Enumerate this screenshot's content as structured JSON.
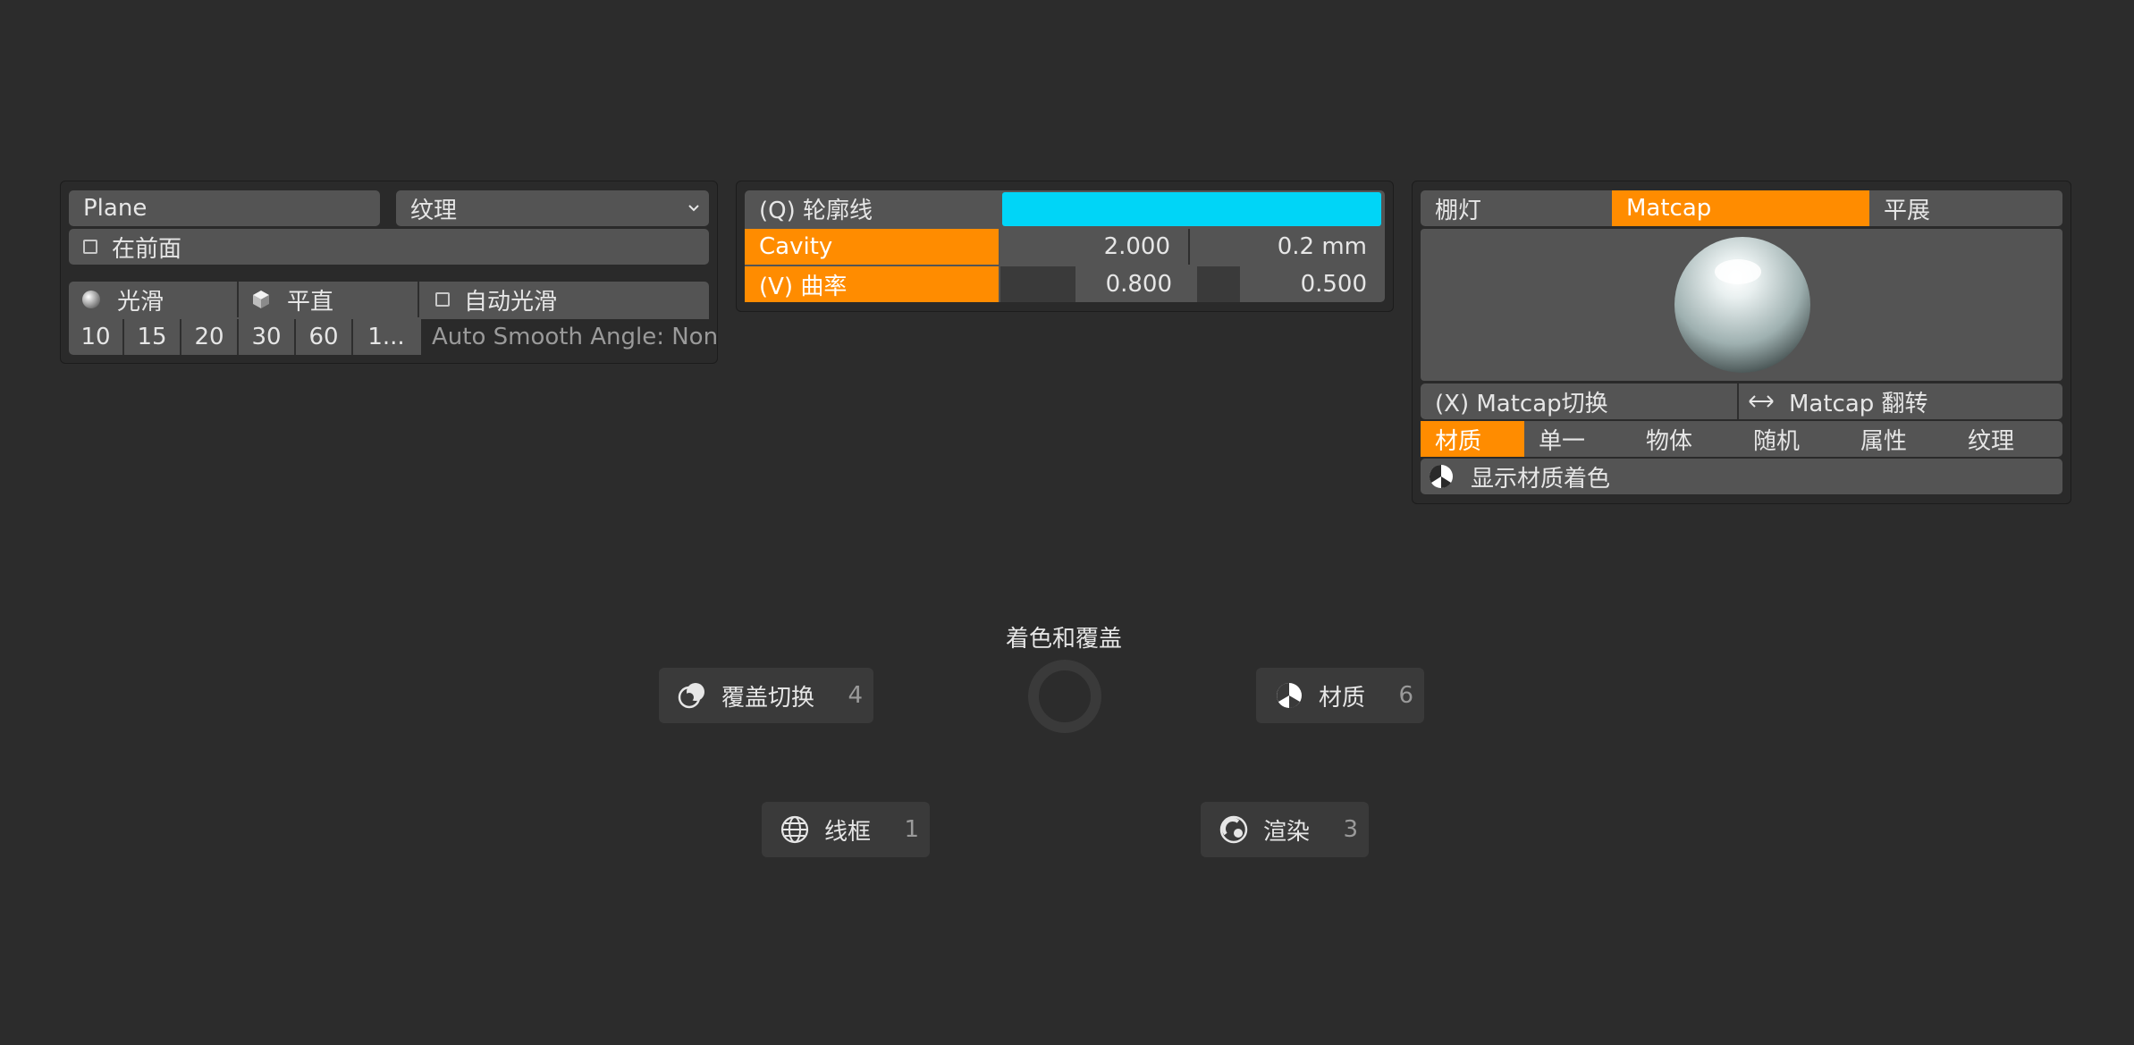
{
  "colors": {
    "background": "#2c2c2c",
    "widget": "#545454",
    "accent_orange": "#ff8c00",
    "outline_cyan": "#00d5f7"
  },
  "left_panel": {
    "object_field": "Plane",
    "texture_dropdown": {
      "selected": "纹理",
      "icon": "chevron-down-icon"
    },
    "in_front_label": "在前面",
    "shading": {
      "smooth_label": "光滑",
      "flat_label": "平直",
      "auto_smooth_label": "自动光滑"
    },
    "angles": [
      "10",
      "15",
      "20",
      "30",
      "60",
      "1..."
    ],
    "auto_smooth_angle_text": "Auto Smooth Angle: None"
  },
  "middle_panel": {
    "outline": {
      "label": "(Q) 轮廓线",
      "color": "#00d5f7"
    },
    "cavity": {
      "label": "Cavity",
      "value1": "2.000",
      "value2": "0.2 mm"
    },
    "curvature": {
      "label": "(V) 曲率",
      "value1": "0.800",
      "value2": "0.500"
    }
  },
  "right_panel": {
    "lighting_tabs": [
      "棚灯",
      "Matcap",
      "平展"
    ],
    "active_lighting": "Matcap",
    "matcap_toggle_label": "(X) Matcap切换",
    "matcap_flip_label": "Matcap 翻转",
    "color_tabs": [
      "材质",
      "单一",
      "物体",
      "随机",
      "属性",
      "纹理"
    ],
    "active_color_tab": "材质",
    "show_material_label": "显示材质着色"
  },
  "pie_menu": {
    "title": "着色和覆盖",
    "items": [
      {
        "label": "覆盖切换",
        "key": "4",
        "icon": "overlay-icon"
      },
      {
        "label": "材质",
        "key": "6",
        "icon": "material-icon"
      },
      {
        "label": "线框",
        "key": "1",
        "icon": "wireframe-icon"
      },
      {
        "label": "渲染",
        "key": "3",
        "icon": "rendered-icon"
      }
    ]
  }
}
